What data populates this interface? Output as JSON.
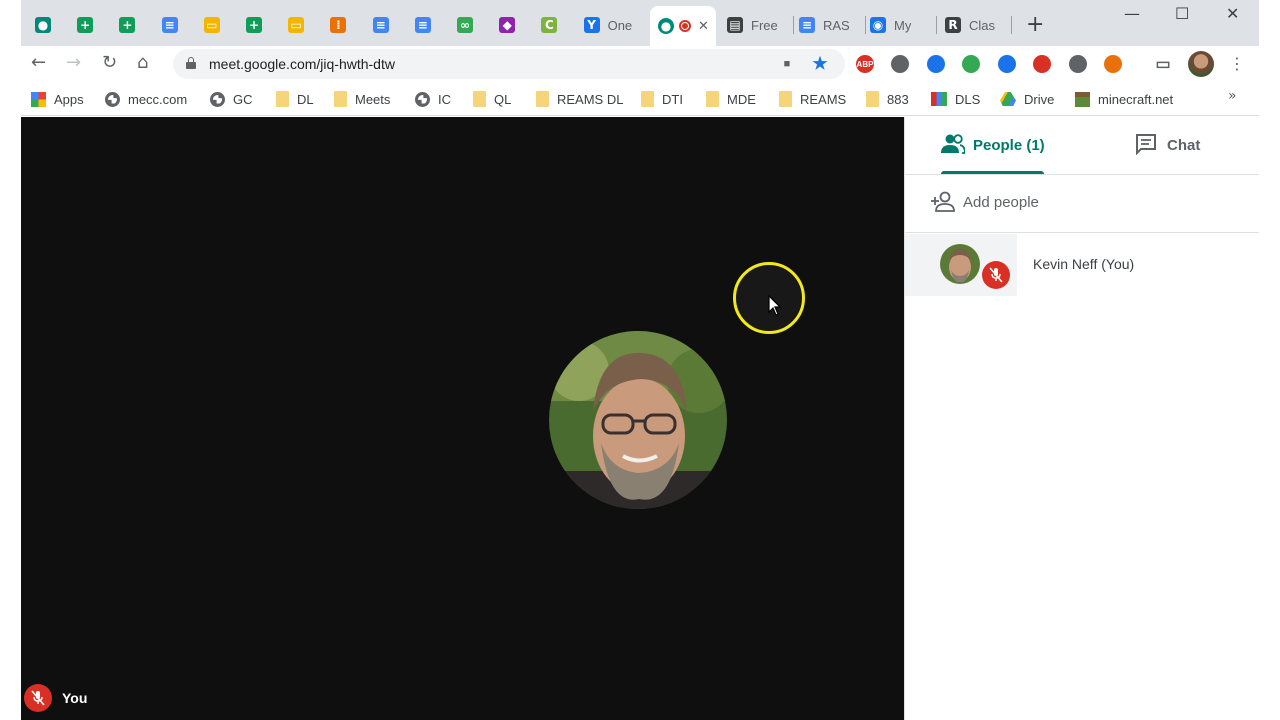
{
  "browser": {
    "tabs": [
      {
        "title": "",
        "icon": "meet-icon",
        "color": "#00897b"
      },
      {
        "title": "",
        "icon": "sheets-icon",
        "color": "#0f9d58"
      },
      {
        "title": "",
        "icon": "sheets-icon",
        "color": "#0f9d58"
      },
      {
        "title": "",
        "icon": "docs-icon",
        "color": "#4285f4"
      },
      {
        "title": "",
        "icon": "slides-icon",
        "color": "#f4b400"
      },
      {
        "title": "",
        "icon": "sheets-icon",
        "color": "#0f9d58"
      },
      {
        "title": "",
        "icon": "slides-icon",
        "color": "#f4b400"
      },
      {
        "title": "",
        "icon": "apps-grid-icon",
        "color": "#e8710a"
      },
      {
        "title": "",
        "icon": "docs-icon",
        "color": "#4285f4"
      },
      {
        "title": "",
        "icon": "docs-icon",
        "color": "#4285f4"
      },
      {
        "title": "",
        "icon": "infinity-icon",
        "color": "#34a853"
      },
      {
        "title": "",
        "icon": "contacts-icon",
        "color": "#8e24aa"
      },
      {
        "title": "",
        "icon": "c-app-icon",
        "color": "#7cb342"
      },
      {
        "title": "One",
        "icon": "y-icon",
        "color": "#1a73e8"
      }
    ],
    "tabs_right": [
      {
        "title": "Free",
        "icon": "free-icon",
        "color": "#3c4043"
      },
      {
        "title": "RAS",
        "icon": "docs-icon",
        "color": "#4285f4"
      },
      {
        "title": "My",
        "icon": "chrome-icon",
        "color": "#1a73e8"
      },
      {
        "title": "Clas",
        "icon": "r-icon",
        "color": "#3c4043"
      }
    ],
    "active_tab": {
      "icon": "meet-icon",
      "close": "✕"
    },
    "new_tab": "+",
    "window_controls": {
      "minimize": "—",
      "maximize": "☐",
      "close": "✕"
    },
    "url": "meet.google.com/jiq-hwth-dtw",
    "extensions": [
      {
        "icon": "video-camera-icon",
        "color": "#5f6368",
        "label": ""
      },
      {
        "icon": "star-icon",
        "color": "#1a73e8",
        "label": ""
      },
      {
        "icon": "adblock-icon",
        "color": "#d93025",
        "label": "ABP"
      },
      {
        "icon": "extension-drive-icon",
        "color": "#5f6368",
        "label": ""
      },
      {
        "icon": "y-extension-icon",
        "color": "#1a73e8",
        "label": ""
      },
      {
        "icon": "cast-green-icon",
        "color": "#34a853",
        "label": ""
      },
      {
        "icon": "snowflake-icon",
        "color": "#1a73e8",
        "label": ""
      },
      {
        "icon": "pdf-icon",
        "color": "#d93025",
        "label": ""
      },
      {
        "icon": "circle-extension-icon",
        "color": "#5f6368",
        "label": ""
      },
      {
        "icon": "orange-extension-icon",
        "color": "#e8710a",
        "label": ""
      },
      {
        "icon": "cast-icon",
        "color": "#5f6368",
        "label": ""
      }
    ],
    "bookmarks": [
      {
        "label": "Apps",
        "icon": "apps-grid-icon"
      },
      {
        "label": "mecc.com",
        "icon": "globe-icon"
      },
      {
        "label": "GC",
        "icon": "globe-icon"
      },
      {
        "label": "DL",
        "icon": "folder-icon"
      },
      {
        "label": "Meets",
        "icon": "folder-icon"
      },
      {
        "label": "IC",
        "icon": "globe-icon"
      },
      {
        "label": "QL",
        "icon": "folder-icon"
      },
      {
        "label": "REAMS DL",
        "icon": "folder-icon"
      },
      {
        "label": "DTI",
        "icon": "folder-icon"
      },
      {
        "label": "MDE",
        "icon": "folder-icon"
      },
      {
        "label": "REAMS",
        "icon": "folder-icon"
      },
      {
        "label": "883",
        "icon": "folder-icon"
      },
      {
        "label": "DLS",
        "icon": "books-icon"
      },
      {
        "label": "Drive",
        "icon": "drive-icon"
      },
      {
        "label": "minecraft.net",
        "icon": "minecraft-icon"
      }
    ],
    "bookmarks_overflow": "»"
  },
  "meet": {
    "self_label": "You",
    "people_tab": "People (1)",
    "chat_tab": "Chat",
    "add_people": "Add people",
    "participants": [
      {
        "name": "Kevin Neff (You)",
        "muted": true
      }
    ],
    "colors": {
      "accent": "#00796b",
      "muted_red": "#d93025",
      "stage_bg": "#0f0f0f",
      "cursor_ring": "#f2e91b"
    }
  }
}
